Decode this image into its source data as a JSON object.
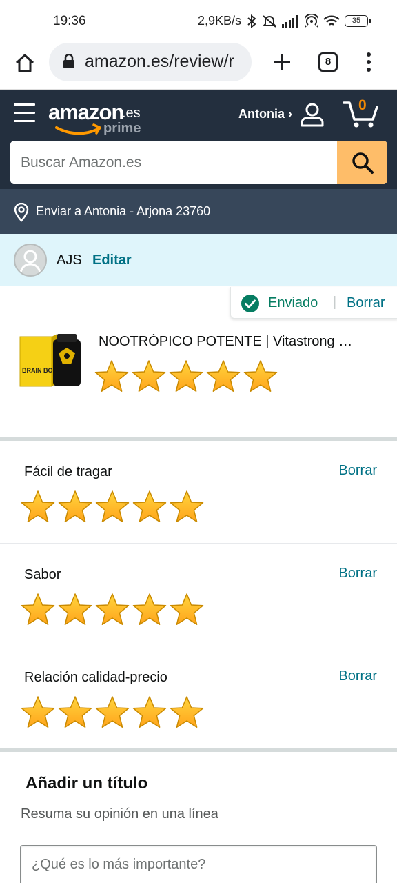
{
  "status_bar": {
    "time": "19:36",
    "net_speed": "2,9KB/s",
    "battery": "35",
    "icons": [
      "bluetooth-icon",
      "mute-icon",
      "signal-icon",
      "hotspot-icon",
      "wifi-icon",
      "battery-icon"
    ]
  },
  "browser": {
    "url": "amazon.es/review/r",
    "tab_count": "8",
    "icons": [
      "home-icon",
      "lock-icon",
      "plus-icon",
      "tabs-icon",
      "more-vert-icon"
    ]
  },
  "header": {
    "logo_text": "amazon",
    "logo_tld": ".es",
    "logo_sub": "prime",
    "account_label": "Antonia ›",
    "cart_count": "0",
    "search_placeholder": "Buscar Amazon.es",
    "deliver_to": "Enviar a Antonia - Arjona 23760",
    "colors": {
      "header_bg": "#232f3e",
      "deliver_bg": "#37475a",
      "search_btn": "#febd69",
      "cart_count": "#f08804"
    }
  },
  "profile": {
    "name": "AJS",
    "edit_label": "Editar"
  },
  "submission": {
    "status_label": "Enviado",
    "separator": "|",
    "delete_label": "Borrar",
    "status_color": "#067d62"
  },
  "product": {
    "title": "NOOTRÓPICO POTENTE | Vitastrong Brain Booster",
    "image_label": "BRAIN BOOSTER",
    "rating": 5,
    "rating_max": 5
  },
  "attributes": [
    {
      "label": "Fácil de tragar",
      "delete_label": "Borrar",
      "rating": 5
    },
    {
      "label": "Sabor",
      "delete_label": "Borrar",
      "rating": 5
    },
    {
      "label": "Relación calidad-precio",
      "delete_label": "Borrar",
      "rating": 5
    }
  ],
  "title_section": {
    "heading": "Añadir un título",
    "subheading": "Resuma su opinión en una línea",
    "input_placeholder": "¿Qué es lo más importante?"
  },
  "colors": {
    "star_fill": "#ffa41c",
    "link": "#007185"
  }
}
